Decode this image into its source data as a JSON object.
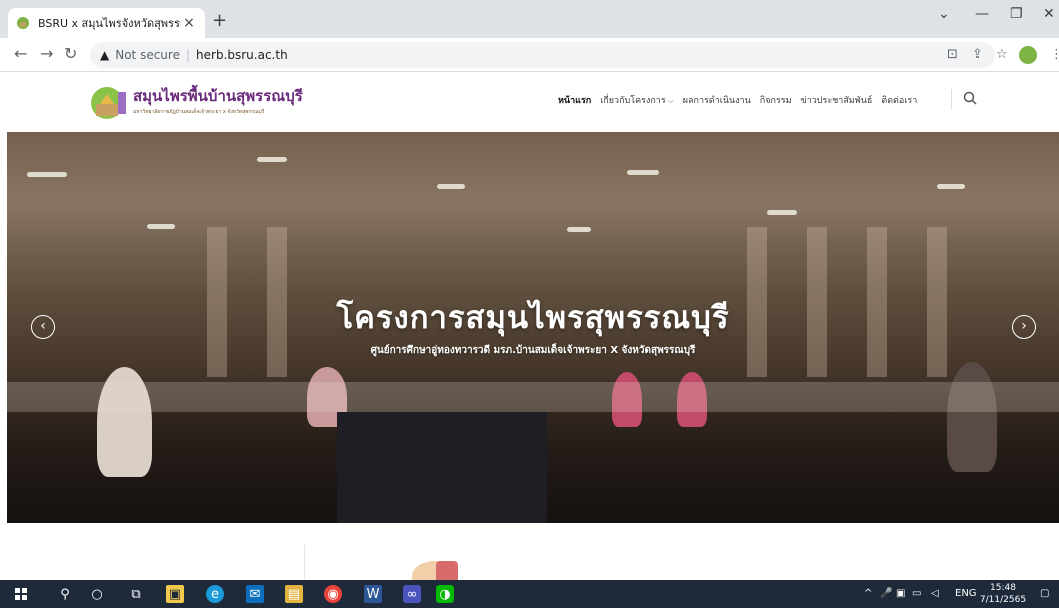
{
  "browser": {
    "tab_title": "BSRU x สมุนไพรจังหวัดสุพรรณบุรี",
    "tab_close": "×",
    "new_tab": "+",
    "security_label": "Not secure",
    "url": "herb.bsru.ac.th",
    "window_controls": [
      "⌄",
      "—",
      "❐",
      "✕"
    ]
  },
  "site": {
    "logo_title": "สมุนไพรพื้นบ้านสุพรรณบุรี",
    "logo_subtitle": "มหาวิทยาลัยราชภัฏบ้านสมเด็จเจ้าพระยา x จังหวัดสุพรรณบุรี",
    "menu": [
      {
        "label": "หน้าแรก",
        "active": true,
        "dropdown": false
      },
      {
        "label": "เกี่ยวกับโครงการ",
        "active": false,
        "dropdown": true
      },
      {
        "label": "ผลการดำเนินงาน",
        "active": false,
        "dropdown": false
      },
      {
        "label": "กิจกรรม",
        "active": false,
        "dropdown": false
      },
      {
        "label": "ข่าวประชาสัมพันธ์",
        "active": false,
        "dropdown": false
      },
      {
        "label": "ติดต่อเรา",
        "active": false,
        "dropdown": false
      }
    ]
  },
  "hero": {
    "title": "โครงการสมุนไพรสุพรรณบุรี",
    "subtitle": "ศูนย์การศึกษาอู่ทองทวารวดี มรภ.บ้านสมเด็จเจ้าพระยา X จังหวัดสุพรรณบุรี",
    "prev_arrow": "‹",
    "next_arrow": "›"
  },
  "taskbar": {
    "language": "ENG",
    "time": "15:48",
    "date": "7/11/2565"
  },
  "colors": {
    "brand_purple": "#6a2c7c",
    "taskbar_bg": "#1e2a3a",
    "tab_strip_bg": "#dee1e6"
  }
}
